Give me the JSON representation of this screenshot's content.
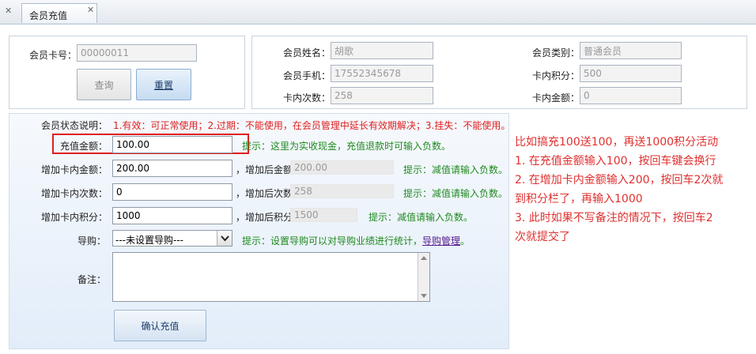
{
  "tab": {
    "title": "会员充值"
  },
  "search": {
    "card_no_label": "会员卡号：",
    "card_no_value": "00000011",
    "query_button": "查询",
    "reset_button": "重置"
  },
  "member": {
    "name_label": "会员姓名：",
    "name_value": "胡歌",
    "category_label": "会员类别：",
    "category_value": "普通会员",
    "phone_label": "会员手机：",
    "phone_value": "17552345678",
    "points_label": "卡内积分：",
    "points_value": "500",
    "times_label": "卡内次数：",
    "times_value": "258",
    "amount_label": "卡内金额：",
    "amount_value": "0"
  },
  "form": {
    "status_label": "会员状态说明：",
    "status_text": "1.有效：可正常使用；2.过期：不能使用，在会员管理中延长有效期解决；3.挂失：不能使用。",
    "recharge_label": "充值金额：",
    "recharge_value": "100.00",
    "recharge_hint": "提示：这里为实收现金，充值退款时可输入负数。",
    "add_amount_label": "增加卡内金额：",
    "add_amount_value": "200.00",
    "after_amount_label": "，增加后金额",
    "after_amount_value": "200.00",
    "add_amount_hint": "提示：减值请输入负数。",
    "add_times_label": "增加卡内次数：",
    "add_times_value": "0",
    "after_times_label": "，增加后次数",
    "after_times_value": "258",
    "add_times_hint": "提示：减值请输入负数。",
    "add_points_label": "增加卡内积分：",
    "add_points_value": "1000",
    "after_points_label": "，增加后积分",
    "after_points_value": "1500",
    "add_points_hint": "提示：减值请输入负数。",
    "guide_label": "导购：",
    "guide_selected": "---未设置导购---",
    "guide_hint_prefix": "提示：设置导购可以对导购业绩进行统计，",
    "guide_hint_link": "导购管理",
    "guide_hint_suffix": "。",
    "remark_label": "备注：",
    "remark_value": "",
    "confirm_button": "确认充值"
  },
  "annotation": {
    "line1": "比如搞充100送100，再送1000积分活动",
    "line2": "1. 在充值金额输入100，按回车键会换行",
    "line3": "2. 在增加卡内金额输入200，按回车2次就",
    "line4": "到积分栏了，再输入1000",
    "line5": "3. 此时如果不写备注的情况下，按回车2",
    "line6": "次就提交了"
  },
  "colors": {
    "hint_green": "#1f8a1f",
    "status_red": "#e02020",
    "highlight_box": "#e02020",
    "annotation_red": "#e03030"
  }
}
